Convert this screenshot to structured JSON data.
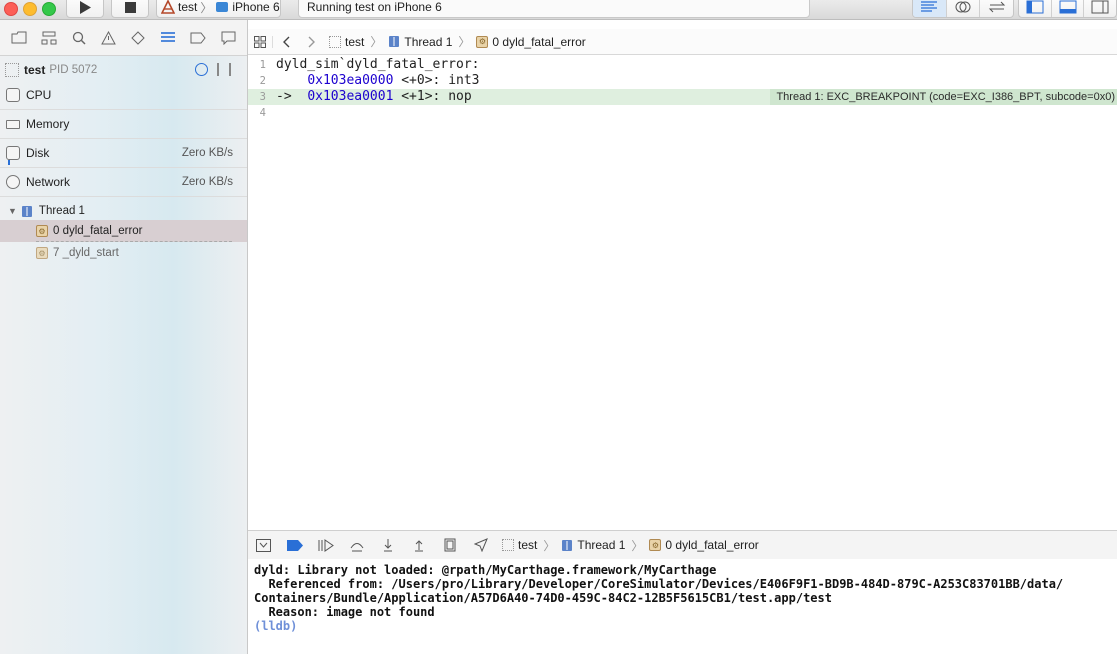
{
  "toolbar": {
    "scheme_target": "test",
    "scheme_device": "iPhone 6",
    "activity_status": "Running test on iPhone 6",
    "traffic_colors": [
      "#fc5f57",
      "#fdbc2e",
      "#34c84a"
    ]
  },
  "navigator": {
    "process": {
      "name": "test",
      "pid": "PID 5072"
    },
    "gauges": [
      {
        "label": "CPU",
        "value": ""
      },
      {
        "label": "Memory",
        "value": ""
      },
      {
        "label": "Disk",
        "value": "Zero KB/s"
      },
      {
        "label": "Network",
        "value": "Zero KB/s"
      }
    ],
    "thread": {
      "label": "Thread 1"
    },
    "frames": [
      {
        "label": "0 dyld_fatal_error"
      },
      {
        "label": "7 _dyld_start"
      }
    ]
  },
  "jumpbar": {
    "crumbs": [
      "test",
      "Thread 1",
      "0 dyld_fatal_error"
    ]
  },
  "code": {
    "lines": [
      {
        "num": "1",
        "text": "dyld_sim`dyld_fatal_error:"
      },
      {
        "num": "2",
        "indent": "    ",
        "addr": "0x103ea0000",
        "rest": " <+0>: int3"
      },
      {
        "num": "3",
        "arrow": "->  ",
        "addr": "0x103ea0001",
        "rest": " <+1>: nop"
      },
      {
        "num": "4",
        "text": ""
      }
    ],
    "breakpoint_message": "Thread 1: EXC_BREAKPOINT (code=EXC_I386_BPT, subcode=0x0)"
  },
  "debugbar": {
    "crumbs": [
      "test",
      "Thread 1",
      "0 dyld_fatal_error"
    ]
  },
  "console": {
    "lines": [
      "dyld: Library not loaded: @rpath/MyCarthage.framework/MyCarthage",
      "  Referenced from: /Users/pro/Library/Developer/CoreSimulator/Devices/E406F9F1-BD9B-484D-879C-A253C83701BB/data/",
      "Containers/Bundle/Application/A57D6A40-74D0-459C-84C2-12B5F5615CB1/test.app/test",
      "  Reason: image not found"
    ],
    "prompt": "(lldb)"
  }
}
